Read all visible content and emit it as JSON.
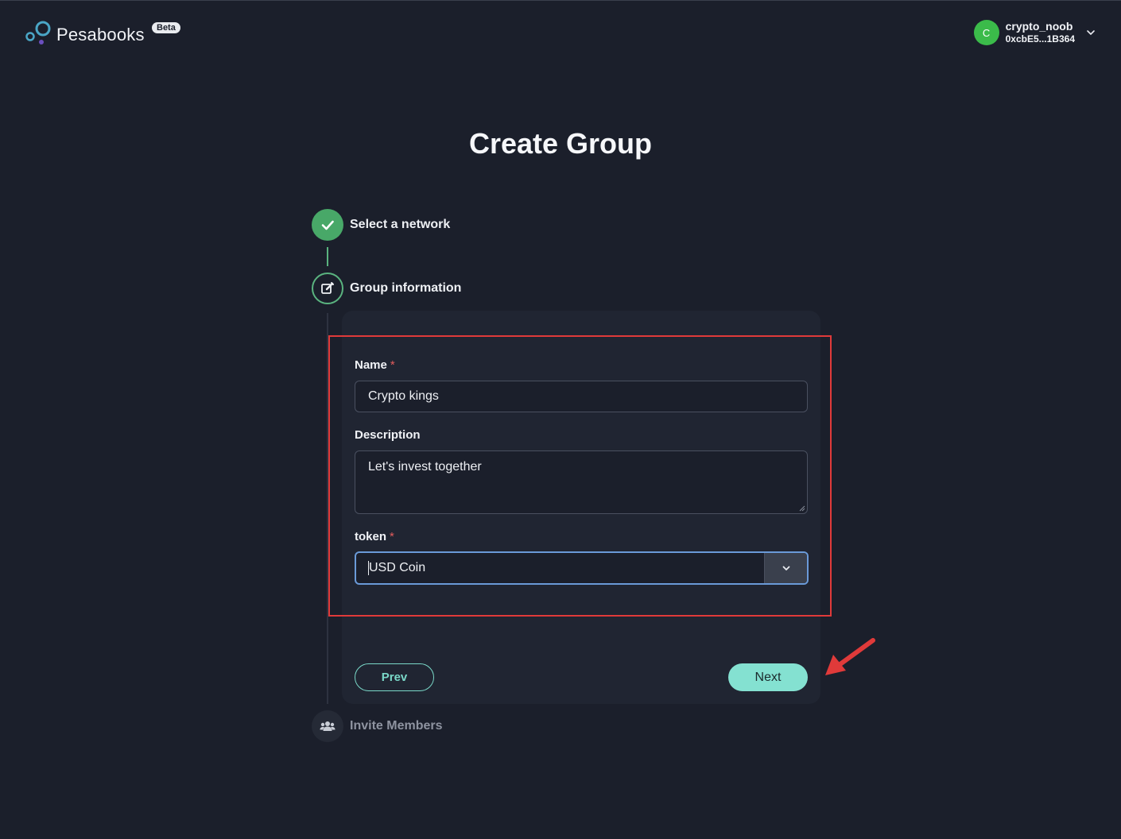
{
  "header": {
    "app_name": "Pesabooks",
    "badge": "Beta",
    "user": {
      "avatar_letter": "C",
      "name": "crypto_noob",
      "address": "0xcbE5...1B364",
      "avatar_color": "#3bbb4a"
    }
  },
  "page": {
    "title": "Create Group"
  },
  "stepper": {
    "steps": [
      {
        "label": "Select a network",
        "state": "completed",
        "icon": "check-icon"
      },
      {
        "label": "Group information",
        "state": "active",
        "icon": "edit-icon"
      },
      {
        "label": "Invite Members",
        "state": "pending",
        "icon": "users-icon"
      }
    ]
  },
  "form": {
    "name": {
      "label": "Name",
      "required_mark": "*",
      "value": "Crypto kings"
    },
    "description": {
      "label": "Description",
      "value": "Let's invest together"
    },
    "token": {
      "label": "token",
      "required_mark": "*",
      "selected": "USD Coin"
    }
  },
  "actions": {
    "prev_label": "Prev",
    "next_label": "Next"
  },
  "colors": {
    "background": "#1b1f2b",
    "card": "#202532",
    "accent": "#84e1d1",
    "success": "#48a868",
    "highlight": "#e03a3a"
  }
}
